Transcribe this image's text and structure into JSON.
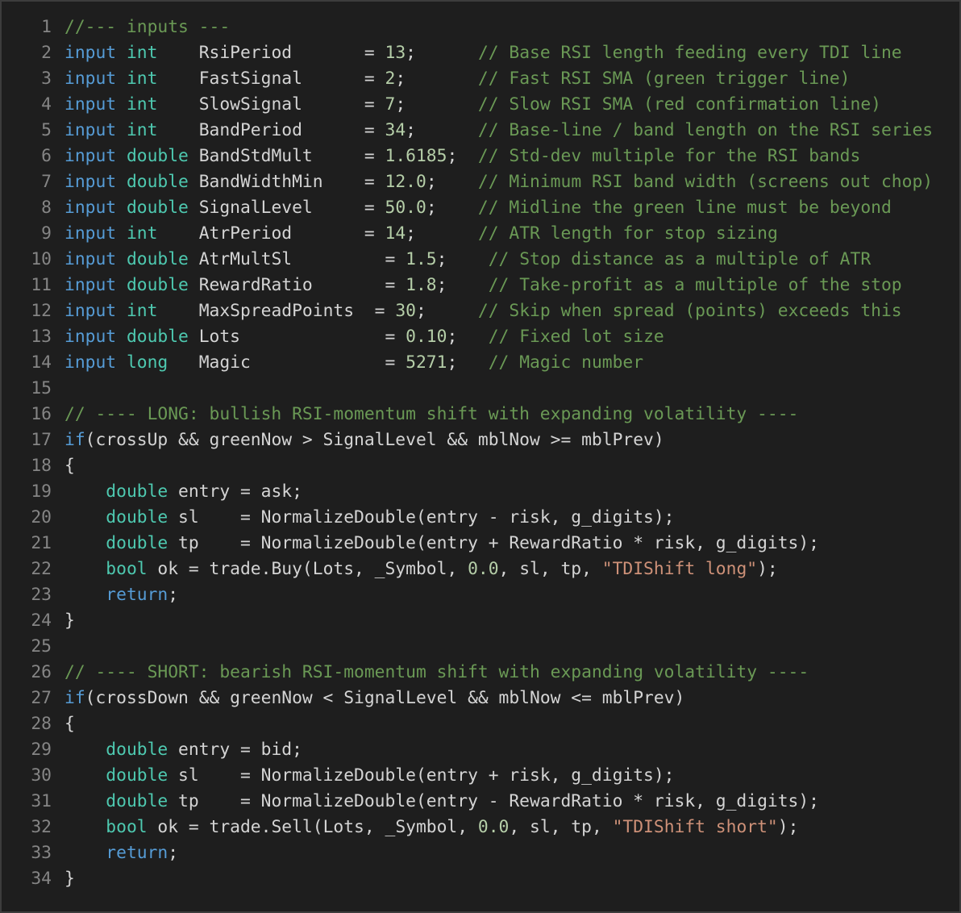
{
  "lines": [
    {
      "n": "1",
      "tokens": [
        [
          "cmt",
          "//--- inputs ---"
        ]
      ]
    },
    {
      "n": "2",
      "tokens": [
        [
          "kw",
          "input"
        ],
        [
          "pun",
          " "
        ],
        [
          "type",
          "int"
        ],
        [
          "pun",
          "    "
        ],
        [
          "id",
          "RsiPeriod"
        ],
        [
          "pun",
          "       = "
        ],
        [
          "num",
          "13"
        ],
        [
          "pun",
          ";      "
        ],
        [
          "cmt",
          "// Base RSI length feeding every TDI line"
        ]
      ]
    },
    {
      "n": "3",
      "tokens": [
        [
          "kw",
          "input"
        ],
        [
          "pun",
          " "
        ],
        [
          "type",
          "int"
        ],
        [
          "pun",
          "    "
        ],
        [
          "id",
          "FastSignal"
        ],
        [
          "pun",
          "      = "
        ],
        [
          "num",
          "2"
        ],
        [
          "pun",
          ";       "
        ],
        [
          "cmt",
          "// Fast RSI SMA (green trigger line)"
        ]
      ]
    },
    {
      "n": "4",
      "tokens": [
        [
          "kw",
          "input"
        ],
        [
          "pun",
          " "
        ],
        [
          "type",
          "int"
        ],
        [
          "pun",
          "    "
        ],
        [
          "id",
          "SlowSignal"
        ],
        [
          "pun",
          "      = "
        ],
        [
          "num",
          "7"
        ],
        [
          "pun",
          ";       "
        ],
        [
          "cmt",
          "// Slow RSI SMA (red confirmation line)"
        ]
      ]
    },
    {
      "n": "5",
      "tokens": [
        [
          "kw",
          "input"
        ],
        [
          "pun",
          " "
        ],
        [
          "type",
          "int"
        ],
        [
          "pun",
          "    "
        ],
        [
          "id",
          "BandPeriod"
        ],
        [
          "pun",
          "      = "
        ],
        [
          "num",
          "34"
        ],
        [
          "pun",
          ";      "
        ],
        [
          "cmt",
          "// Base-line / band length on the RSI series"
        ]
      ]
    },
    {
      "n": "6",
      "tokens": [
        [
          "kw",
          "input"
        ],
        [
          "pun",
          " "
        ],
        [
          "type",
          "double"
        ],
        [
          "pun",
          " "
        ],
        [
          "id",
          "BandStdMult"
        ],
        [
          "pun",
          "     = "
        ],
        [
          "num",
          "1.6185"
        ],
        [
          "pun",
          ";  "
        ],
        [
          "cmt",
          "// Std-dev multiple for the RSI bands"
        ]
      ]
    },
    {
      "n": "7",
      "tokens": [
        [
          "kw",
          "input"
        ],
        [
          "pun",
          " "
        ],
        [
          "type",
          "double"
        ],
        [
          "pun",
          " "
        ],
        [
          "id",
          "BandWidthMin"
        ],
        [
          "pun",
          "    = "
        ],
        [
          "num",
          "12.0"
        ],
        [
          "pun",
          ";    "
        ],
        [
          "cmt",
          "// Minimum RSI band width (screens out chop)"
        ]
      ]
    },
    {
      "n": "8",
      "tokens": [
        [
          "kw",
          "input"
        ],
        [
          "pun",
          " "
        ],
        [
          "type",
          "double"
        ],
        [
          "pun",
          " "
        ],
        [
          "id",
          "SignalLevel"
        ],
        [
          "pun",
          "     = "
        ],
        [
          "num",
          "50.0"
        ],
        [
          "pun",
          ";    "
        ],
        [
          "cmt",
          "// Midline the green line must be beyond"
        ]
      ]
    },
    {
      "n": "9",
      "tokens": [
        [
          "kw",
          "input"
        ],
        [
          "pun",
          " "
        ],
        [
          "type",
          "int"
        ],
        [
          "pun",
          "    "
        ],
        [
          "id",
          "AtrPeriod"
        ],
        [
          "pun",
          "       = "
        ],
        [
          "num",
          "14"
        ],
        [
          "pun",
          ";      "
        ],
        [
          "cmt",
          "// ATR length for stop sizing"
        ]
      ]
    },
    {
      "n": "10",
      "tokens": [
        [
          "kw",
          "input"
        ],
        [
          "pun",
          " "
        ],
        [
          "type",
          "double"
        ],
        [
          "pun",
          " "
        ],
        [
          "id",
          "AtrMultSl"
        ],
        [
          "pun",
          "         = "
        ],
        [
          "num",
          "1.5"
        ],
        [
          "pun",
          ";    "
        ],
        [
          "cmt",
          "// Stop distance as a multiple of ATR"
        ]
      ]
    },
    {
      "n": "11",
      "tokens": [
        [
          "kw",
          "input"
        ],
        [
          "pun",
          " "
        ],
        [
          "type",
          "double"
        ],
        [
          "pun",
          " "
        ],
        [
          "id",
          "RewardRatio"
        ],
        [
          "pun",
          "       = "
        ],
        [
          "num",
          "1.8"
        ],
        [
          "pun",
          ";    "
        ],
        [
          "cmt",
          "// Take-profit as a multiple of the stop"
        ]
      ]
    },
    {
      "n": "12",
      "tokens": [
        [
          "kw",
          "input"
        ],
        [
          "pun",
          " "
        ],
        [
          "type",
          "int"
        ],
        [
          "pun",
          "    "
        ],
        [
          "id",
          "MaxSpreadPoints"
        ],
        [
          "pun",
          "  = "
        ],
        [
          "num",
          "30"
        ],
        [
          "pun",
          ";     "
        ],
        [
          "cmt",
          "// Skip when spread (points) exceeds this"
        ]
      ]
    },
    {
      "n": "13",
      "tokens": [
        [
          "kw",
          "input"
        ],
        [
          "pun",
          " "
        ],
        [
          "type",
          "double"
        ],
        [
          "pun",
          " "
        ],
        [
          "id",
          "Lots"
        ],
        [
          "pun",
          "              = "
        ],
        [
          "num",
          "0.10"
        ],
        [
          "pun",
          ";   "
        ],
        [
          "cmt",
          "// Fixed lot size"
        ]
      ]
    },
    {
      "n": "14",
      "tokens": [
        [
          "kw",
          "input"
        ],
        [
          "pun",
          " "
        ],
        [
          "type",
          "long"
        ],
        [
          "pun",
          "   "
        ],
        [
          "id",
          "Magic"
        ],
        [
          "pun",
          "             = "
        ],
        [
          "num",
          "5271"
        ],
        [
          "pun",
          ";   "
        ],
        [
          "cmt",
          "// Magic number"
        ]
      ]
    },
    {
      "n": "15",
      "tokens": []
    },
    {
      "n": "16",
      "tokens": [
        [
          "cmt",
          "// ---- LONG: bullish RSI-momentum shift with expanding volatility ----"
        ]
      ]
    },
    {
      "n": "17",
      "tokens": [
        [
          "kw",
          "if"
        ],
        [
          "pun",
          "(crossUp && greenNow > SignalLevel && mblNow >= mblPrev)"
        ]
      ]
    },
    {
      "n": "18",
      "tokens": [
        [
          "pun",
          "{"
        ]
      ]
    },
    {
      "n": "19",
      "tokens": [
        [
          "pun",
          "    "
        ],
        [
          "type",
          "double"
        ],
        [
          "pun",
          " entry = ask;"
        ]
      ]
    },
    {
      "n": "20",
      "tokens": [
        [
          "pun",
          "    "
        ],
        [
          "type",
          "double"
        ],
        [
          "pun",
          " sl    = NormalizeDouble(entry - risk, g_digits);"
        ]
      ]
    },
    {
      "n": "21",
      "tokens": [
        [
          "pun",
          "    "
        ],
        [
          "type",
          "double"
        ],
        [
          "pun",
          " tp    = NormalizeDouble(entry + RewardRatio * risk, g_digits);"
        ]
      ]
    },
    {
      "n": "22",
      "tokens": [
        [
          "pun",
          "    "
        ],
        [
          "type",
          "bool"
        ],
        [
          "pun",
          " ok = trade.Buy(Lots, _Symbol, "
        ],
        [
          "num",
          "0.0"
        ],
        [
          "pun",
          ", sl, tp, "
        ],
        [
          "str",
          "\"TDIShift long\""
        ],
        [
          "pun",
          ");"
        ]
      ]
    },
    {
      "n": "23",
      "tokens": [
        [
          "pun",
          "    "
        ],
        [
          "kw",
          "return"
        ],
        [
          "pun",
          ";"
        ]
      ]
    },
    {
      "n": "24",
      "tokens": [
        [
          "pun",
          "}"
        ]
      ]
    },
    {
      "n": "25",
      "tokens": []
    },
    {
      "n": "26",
      "tokens": [
        [
          "cmt",
          "// ---- SHORT: bearish RSI-momentum shift with expanding volatility ----"
        ]
      ]
    },
    {
      "n": "27",
      "tokens": [
        [
          "kw",
          "if"
        ],
        [
          "pun",
          "(crossDown && greenNow < SignalLevel && mblNow <= mblPrev)"
        ]
      ]
    },
    {
      "n": "28",
      "tokens": [
        [
          "pun",
          "{"
        ]
      ]
    },
    {
      "n": "29",
      "tokens": [
        [
          "pun",
          "    "
        ],
        [
          "type",
          "double"
        ],
        [
          "pun",
          " entry = bid;"
        ]
      ]
    },
    {
      "n": "30",
      "tokens": [
        [
          "pun",
          "    "
        ],
        [
          "type",
          "double"
        ],
        [
          "pun",
          " sl    = NormalizeDouble(entry + risk, g_digits);"
        ]
      ]
    },
    {
      "n": "31",
      "tokens": [
        [
          "pun",
          "    "
        ],
        [
          "type",
          "double"
        ],
        [
          "pun",
          " tp    = NormalizeDouble(entry - RewardRatio * risk, g_digits);"
        ]
      ]
    },
    {
      "n": "32",
      "tokens": [
        [
          "pun",
          "    "
        ],
        [
          "type",
          "bool"
        ],
        [
          "pun",
          " ok = trade.Sell(Lots, _Symbol, "
        ],
        [
          "num",
          "0.0"
        ],
        [
          "pun",
          ", sl, tp, "
        ],
        [
          "str",
          "\"TDIShift short\""
        ],
        [
          "pun",
          ");"
        ]
      ]
    },
    {
      "n": "33",
      "tokens": [
        [
          "pun",
          "    "
        ],
        [
          "kw",
          "return"
        ],
        [
          "pun",
          ";"
        ]
      ]
    },
    {
      "n": "34",
      "tokens": [
        [
          "pun",
          "}"
        ]
      ]
    }
  ],
  "colors": {
    "background": "#1e1e1e",
    "line_number": "#858585",
    "keyword": "#569cd6",
    "type": "#4ec9b0",
    "comment": "#6a9955",
    "number": "#b5cea8",
    "string": "#ce9178",
    "text": "#d4d4d4"
  }
}
